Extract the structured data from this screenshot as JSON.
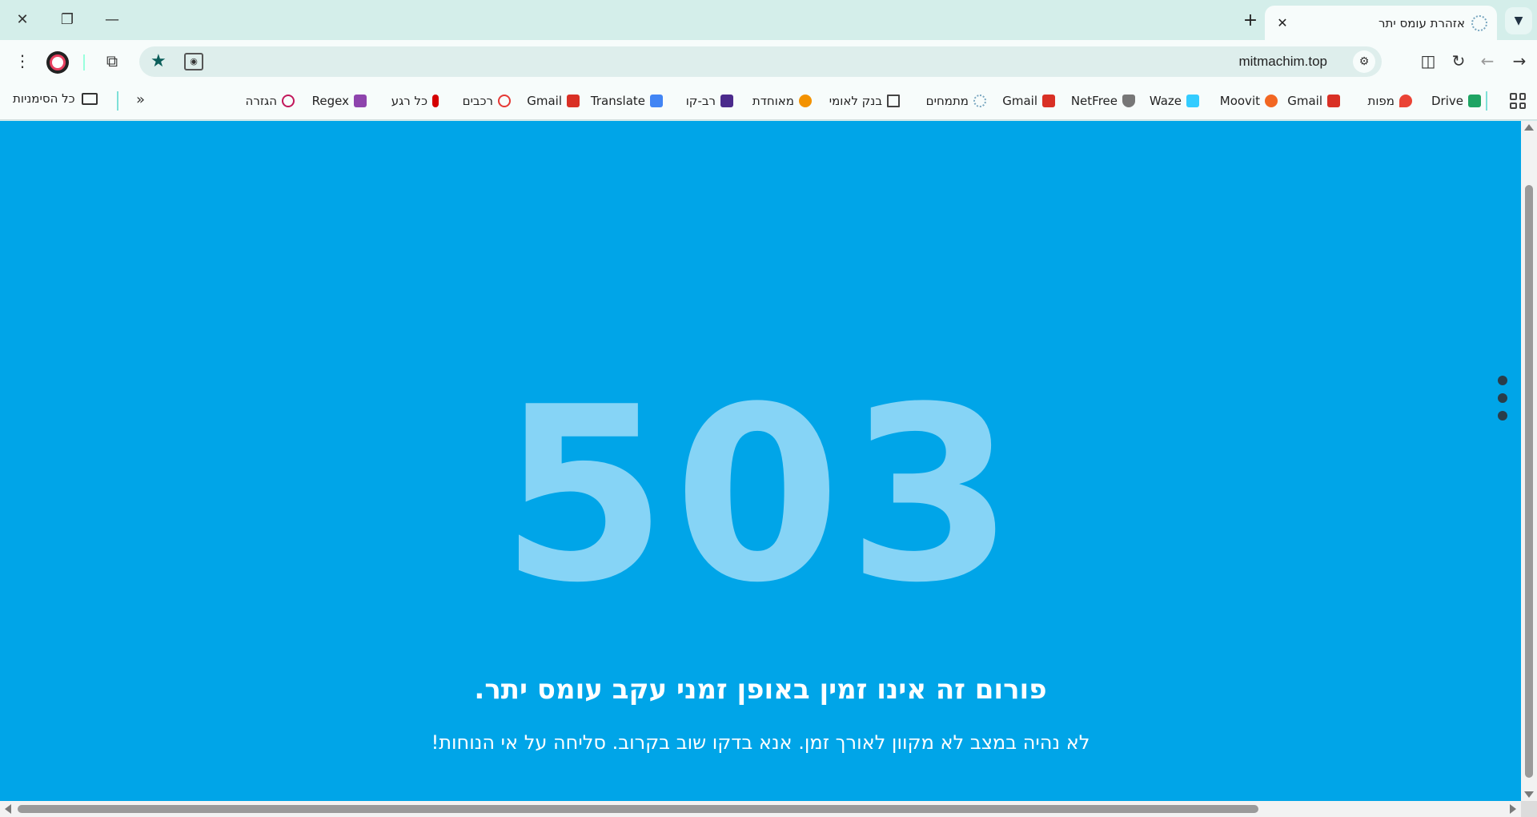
{
  "tab": {
    "title": "אזהרת עומס יתר",
    "favicon": "forum-favicon-icon"
  },
  "toolbar": {
    "url": "mitmachim.top"
  },
  "bookmarks": [
    {
      "label": "Drive",
      "icon": "google-drive-icon",
      "color": "#1fa463"
    },
    {
      "label": "מפות",
      "icon": "google-maps-icon",
      "color": "#ea4335"
    },
    {
      "label": "Gmail",
      "icon": "gmail-icon",
      "color": "#d93025"
    },
    {
      "label": "Moovit",
      "icon": "moovit-icon",
      "color": "#f26722"
    },
    {
      "label": "Waze",
      "icon": "waze-icon",
      "color": "#33ccff"
    },
    {
      "label": "NetFree",
      "icon": "netfree-shield-icon",
      "color": "#777777"
    },
    {
      "label": "Gmail",
      "icon": "gmail-icon",
      "color": "#d93025"
    },
    {
      "label": "מתמחים",
      "icon": "forum-icon",
      "color": "#7aa7c0"
    },
    {
      "label": "בנק לאומי",
      "icon": "document-icon",
      "color": "#444444"
    },
    {
      "label": "מאוחדת",
      "icon": "meuhedet-icon",
      "color": "#f39200"
    },
    {
      "label": "רב-קו",
      "icon": "rav-kav-icon",
      "color": "#4b2a8c"
    },
    {
      "label": "Translate",
      "icon": "google-translate-icon",
      "color": "#4285f4"
    },
    {
      "label": "Gmail",
      "icon": "gmail-icon",
      "color": "#d93025"
    },
    {
      "label": "רכבים",
      "icon": "car-icon",
      "color": "#e53935"
    },
    {
      "label": "כל רגע",
      "icon": "kol-rega-icon",
      "color": "#d50000"
    },
    {
      "label": "Regex",
      "icon": "regex-check-icon",
      "color": "#8e44ad"
    },
    {
      "label": "הגזרה",
      "icon": "hagizra-icon",
      "color": "#c2185b"
    }
  ],
  "bookmarks_all": "כל הסימניות",
  "error": {
    "code": "503",
    "headline": "פורום זה אינו זמין באופן זמני עקב עומס יתר.",
    "message": "לא נהיה במצב לא מקוון לאורך זמן. אנא בדקו שוב בקרוב. סליחה על אי הנוחות!"
  },
  "colors": {
    "page_background": "#00a5e8",
    "code_color": "#86d4f6",
    "text_color": "#ffffff"
  }
}
